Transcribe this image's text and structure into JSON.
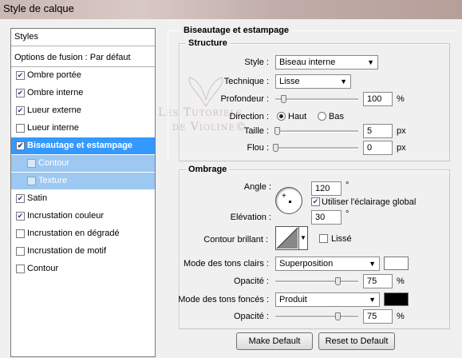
{
  "window": {
    "title": "Style de calque"
  },
  "left_panel": {
    "styles_header": "Styles",
    "blend_options": "Options de fusion : Par défaut",
    "items": [
      {
        "label": "Ombre portée",
        "checked": true
      },
      {
        "label": "Ombre interne",
        "checked": true
      },
      {
        "label": "Lueur externe",
        "checked": true
      },
      {
        "label": "Lueur interne",
        "checked": false
      },
      {
        "label": "Biseautage et estampage",
        "checked": true,
        "selected": true
      },
      {
        "label": "Contour",
        "checked": false,
        "sub": true
      },
      {
        "label": "Texture",
        "checked": false,
        "sub": true
      },
      {
        "label": "Satin",
        "checked": true
      },
      {
        "label": "Incrustation couleur",
        "checked": true
      },
      {
        "label": "Incrustation en dégradé",
        "checked": false
      },
      {
        "label": "Incrustation de motif",
        "checked": false
      },
      {
        "label": "Contour",
        "checked": false
      }
    ]
  },
  "bevel": {
    "title": "Biseautage et estampage",
    "structure": {
      "title": "Structure",
      "style_label": "Style :",
      "style_value": "Biseau interne",
      "technique_label": "Technique :",
      "technique_value": "Lisse",
      "depth_label": "Profondeur :",
      "depth_value": "100",
      "depth_unit": "%",
      "depth_fraction": 0.1,
      "direction_label": "Direction :",
      "direction_up": "Haut",
      "direction_down": "Bas",
      "size_label": "Taille :",
      "size_value": "5",
      "size_unit": "px",
      "size_fraction": 0.02,
      "soften_label": "Flou :",
      "soften_value": "0",
      "soften_unit": "px",
      "soften_fraction": 0.0
    },
    "shading": {
      "title": "Ombrage",
      "angle_label": "Angle :",
      "angle_value": "120",
      "angle_unit": "°",
      "global_light_label": "Utiliser l'éclairage global",
      "global_light_checked": true,
      "altitude_label": "Elévation :",
      "altitude_value": "30",
      "altitude_unit": "°",
      "gloss_label": "Contour brillant :",
      "antialias_label": "Lissé",
      "highlight_mode_label": "Mode des tons clairs :",
      "highlight_mode_value": "Superposition",
      "highlight_color": "#ffffff",
      "highlight_opacity_label": "Opacité :",
      "highlight_opacity_value": "75",
      "highlight_opacity_unit": "%",
      "highlight_opacity_fraction": 0.75,
      "shadow_mode_label": "Mode des tons foncés :",
      "shadow_mode_value": "Produit",
      "shadow_color": "#000000",
      "shadow_opacity_label": "Opacité :",
      "shadow_opacity_value": "75",
      "shadow_opacity_unit": "%",
      "shadow_opacity_fraction": 0.75
    }
  },
  "buttons": {
    "make_default": "Make Default",
    "reset_default": "Reset to Default"
  },
  "watermark": {
    "line1": "Les Tutoriels",
    "line2": "de Violine©"
  },
  "colors": {
    "selected_bg": "#3399ff",
    "sub_bg": "#9cc8f2"
  }
}
